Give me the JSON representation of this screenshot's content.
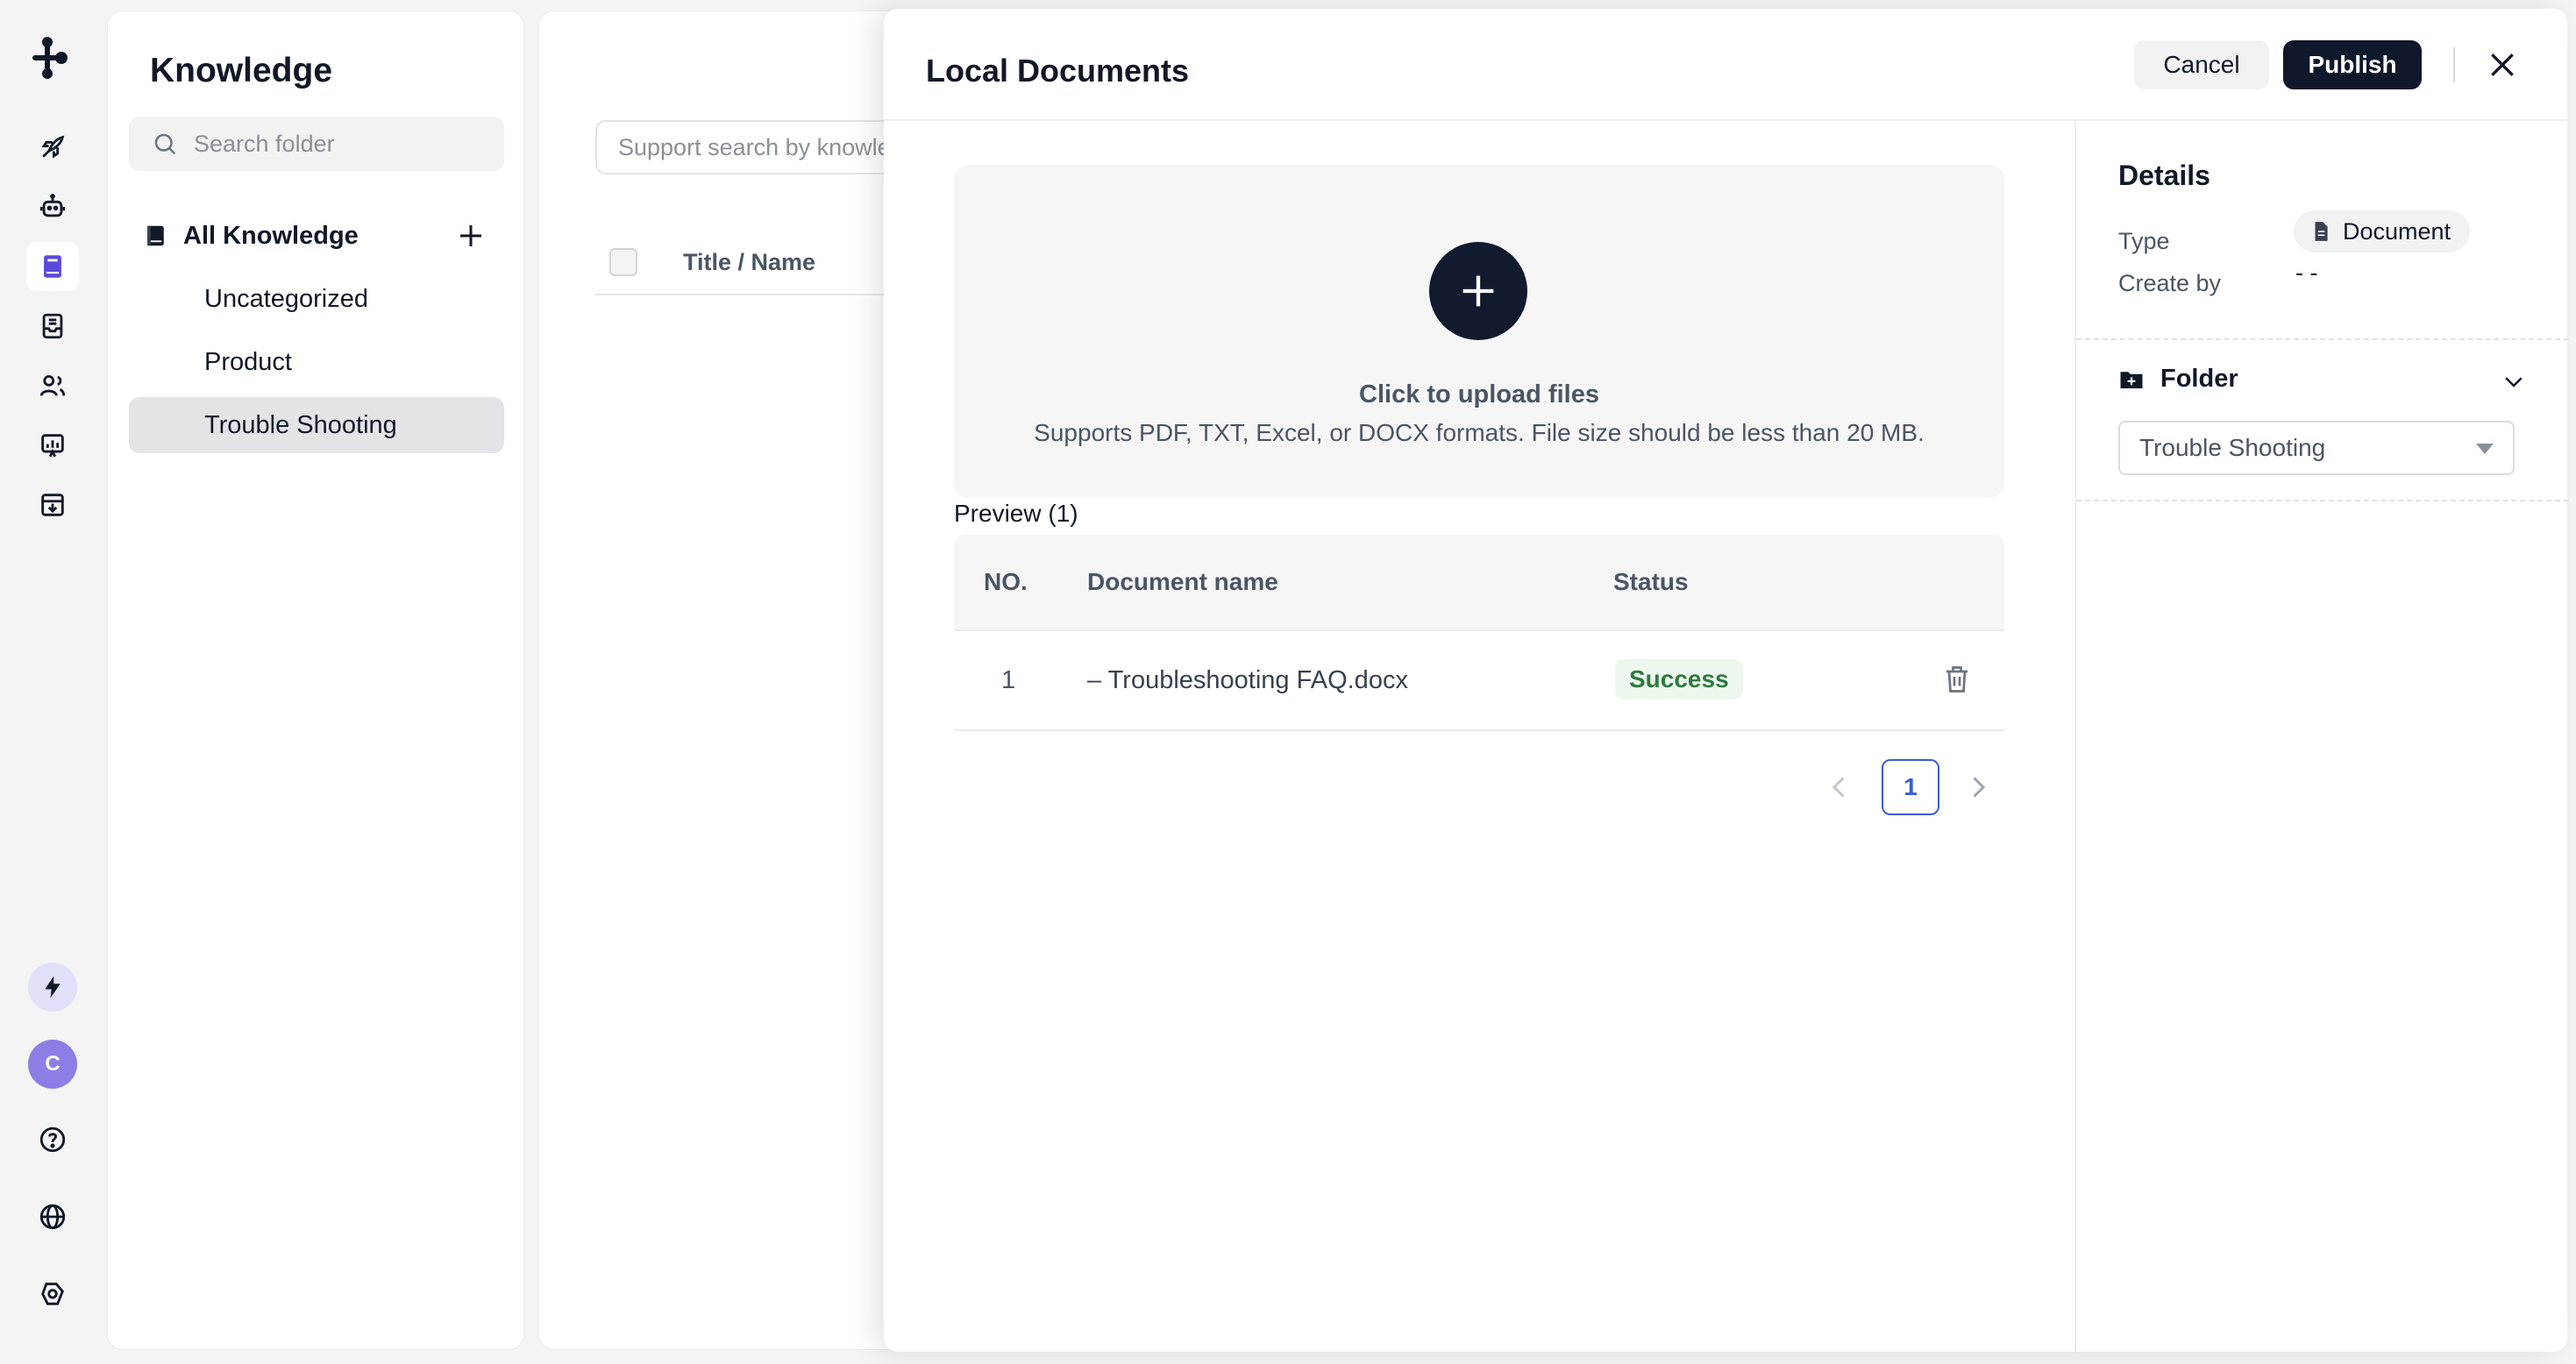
{
  "rail": {
    "items": [
      {
        "icon": "rocket-icon"
      },
      {
        "icon": "robot-icon"
      },
      {
        "icon": "book-icon",
        "active": true
      },
      {
        "icon": "inbox-icon"
      },
      {
        "icon": "users-icon"
      },
      {
        "icon": "analytics-icon"
      },
      {
        "icon": "archive-icon"
      }
    ],
    "avatar_initial": "C"
  },
  "knowledge": {
    "title": "Knowledge",
    "search_placeholder": "Search folder",
    "all_label": "All Knowledge",
    "folders": [
      {
        "label": "Uncategorized",
        "active": false
      },
      {
        "label": "Product",
        "active": false
      },
      {
        "label": "Trouble Shooting",
        "active": true
      }
    ]
  },
  "main": {
    "search_placeholder": "Support search by knowledge",
    "column_title": "Title / Name"
  },
  "drawer": {
    "title": "Local Documents",
    "cancel_label": "Cancel",
    "publish_label": "Publish",
    "upload": {
      "title": "Click to upload files",
      "hint": "Supports PDF, TXT, Excel, or DOCX formats. File size should be less than 20 MB."
    },
    "preview_label": "Preview (1)",
    "table": {
      "headers": {
        "no": "NO.",
        "name": "Document name",
        "status": "Status"
      },
      "rows": [
        {
          "no": "1",
          "name": "– Troubleshooting FAQ.docx",
          "status": "Success"
        }
      ]
    },
    "pager": {
      "current": "1"
    },
    "details": {
      "title": "Details",
      "type_key": "Type",
      "type_value": "Document",
      "create_key": "Create by",
      "create_value": "- -",
      "folder_label": "Folder",
      "folder_selected": "Trouble Shooting"
    }
  },
  "colors": {
    "accent": "#0f172a",
    "page_link": "#3b5bdb",
    "success_text": "#2f7a3f",
    "success_bg": "#edf7ee",
    "avatar": "#8b7fe6"
  }
}
